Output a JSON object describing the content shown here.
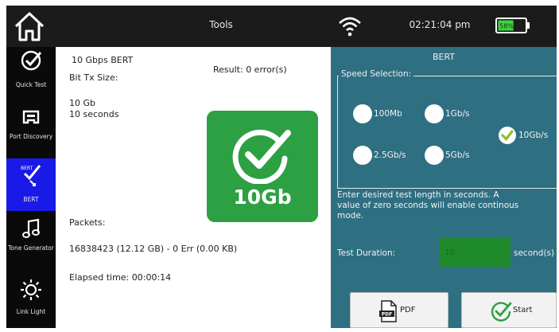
{
  "header": {
    "title": "Tools",
    "time": "02:21:04 pm",
    "battery": "58%",
    "battery_color": "#3fd43f"
  },
  "sidebar": {
    "items": [
      {
        "label": "Quick Test",
        "icon": "check-circle-icon"
      },
      {
        "label": "Port Discovery",
        "icon": "port-icon"
      },
      {
        "label": "BERT",
        "icon": "bert-icon",
        "active": true
      },
      {
        "label": "Tone Generator",
        "icon": "music-note-icon"
      },
      {
        "label": "Link Light",
        "icon": "light-icon"
      }
    ],
    "active_color": "#1a1ae8"
  },
  "test": {
    "name": "10 Gbps BERT",
    "result": "Result: 0 error(s)",
    "bit_tx_label": "Bit Tx Size:",
    "size": "10 Gb",
    "duration": "10 seconds",
    "badge": "10Gb",
    "badge_color": "#2ca043",
    "packets_label": "Packets:",
    "packets_value": "16838423 (12.12 GB) - 0 Err (0.00 KB)",
    "elapsed": "Elapsed time: 00:00:14"
  },
  "panel": {
    "title": "BERT",
    "speed_legend": "Speed Selection:",
    "speeds": [
      "100Mb",
      "1Gb/s",
      "10Gb/s",
      "2.5Gb/s",
      "5Gb/s"
    ],
    "selected_speed": "10Gb/s",
    "description_lines": [
      "Enter desired test length in seconds. A",
      "value of zero seconds will enable continous",
      "mode."
    ],
    "duration_label": "Test Duration:",
    "duration_value": "10",
    "duration_unit": "second(s)",
    "pdf_label": "PDF",
    "start_label": "Start",
    "bg_color": "#2e6f82"
  }
}
